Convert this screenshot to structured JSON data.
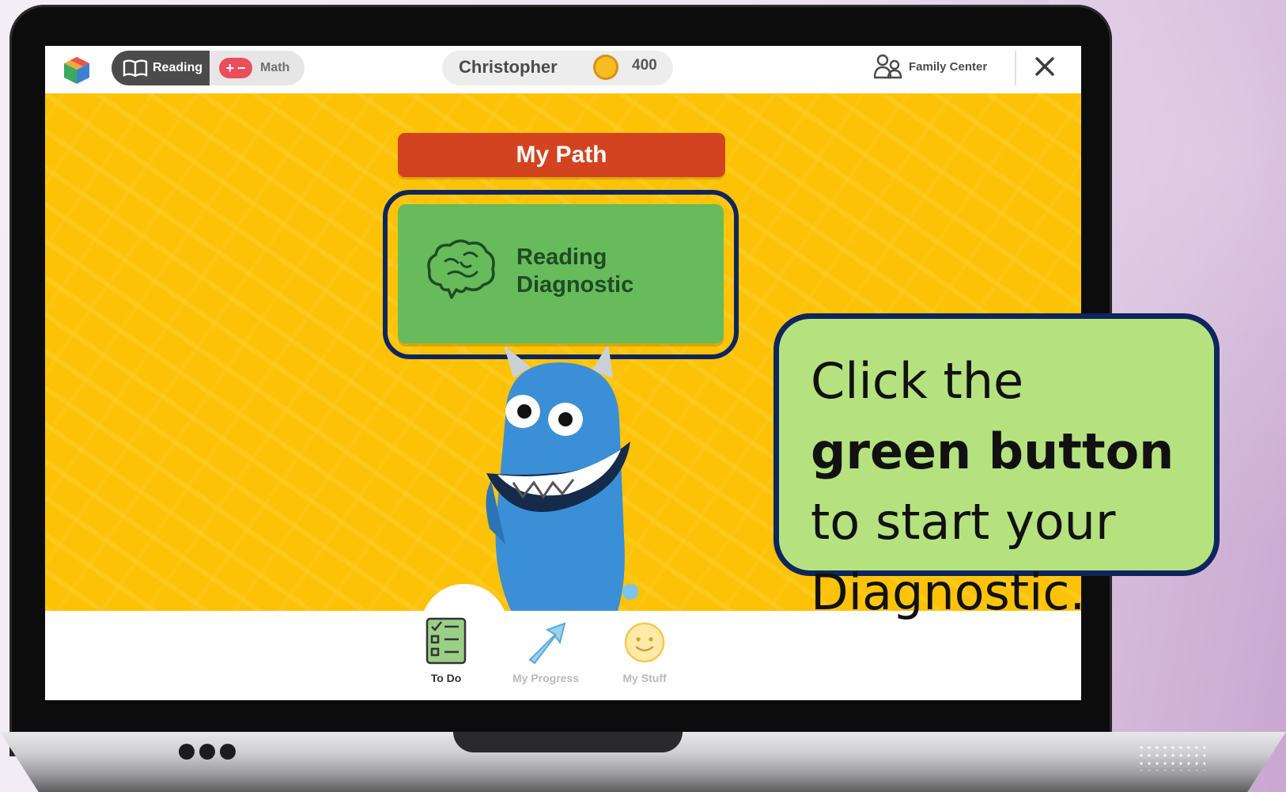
{
  "topbar": {
    "tab_reading": "Reading",
    "tab_math": "Math",
    "user_name": "Christopher",
    "coins": "400",
    "family_center": "Family Center"
  },
  "main": {
    "heading": "My Path",
    "diagnostic_button": "Reading\nDiagnostic"
  },
  "bottom_nav": {
    "items": [
      {
        "label": "To Do",
        "icon": "checklist-icon",
        "active": true
      },
      {
        "label": "My Progress",
        "icon": "arrow-up-right-icon",
        "active": false
      },
      {
        "label": "My Stuff",
        "icon": "smiley-icon",
        "active": false
      }
    ]
  },
  "callout": {
    "text_1": "Click the ",
    "bold_1": "green button",
    "text_2": " to start your Diagnostic."
  },
  "colors": {
    "stage_yellow": "#fcc207",
    "heading_red": "#d3431f",
    "button_green": "#67bb5b",
    "callout_green": "#b5e27f",
    "navy_outline": "#0e255e"
  }
}
